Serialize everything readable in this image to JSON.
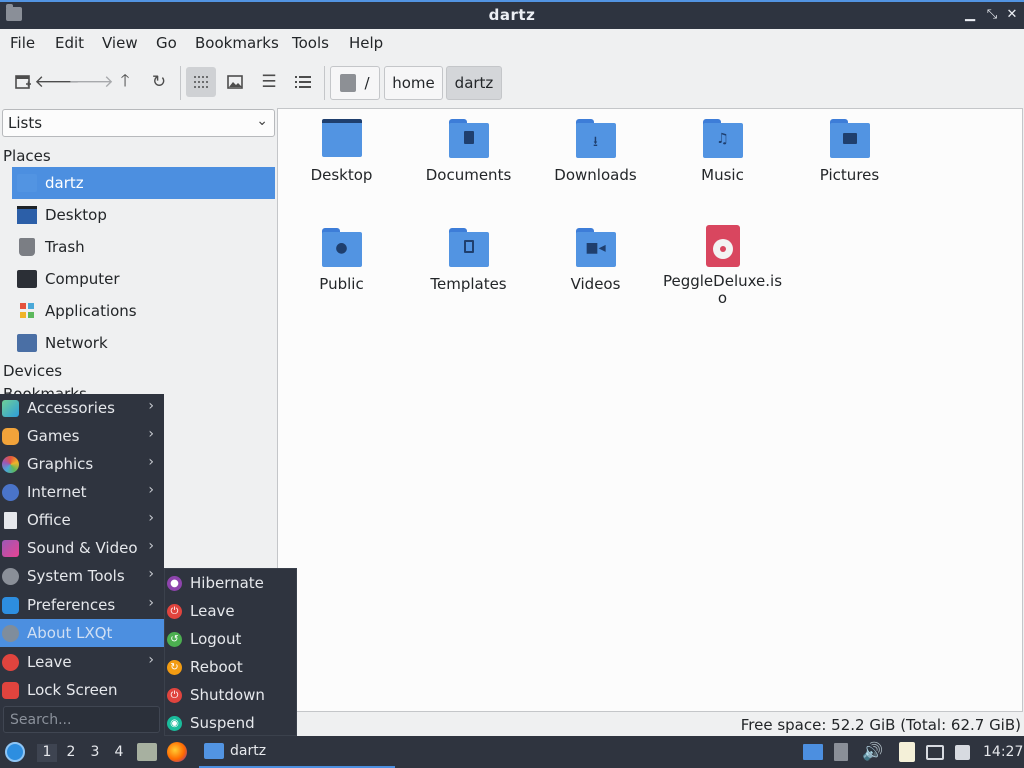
{
  "window": {
    "title": "dartz"
  },
  "menubar": [
    "File",
    "Edit",
    "View",
    "Go",
    "Bookmarks",
    "Tools",
    "Help"
  ],
  "breadcrumb": {
    "root": "/",
    "parts": [
      "home",
      "dartz"
    ]
  },
  "side": {
    "dropdown_value": "Lists",
    "places_header": "Places",
    "places": [
      "dartz",
      "Desktop",
      "Trash",
      "Computer",
      "Applications",
      "Network"
    ],
    "devices_header": "Devices",
    "bookmarks_header": "Bookmarks"
  },
  "files": [
    {
      "name": "Desktop",
      "icon": "desktop-folder-icon"
    },
    {
      "name": "Documents",
      "icon": "documents-folder-icon"
    },
    {
      "name": "Downloads",
      "icon": "downloads-folder-icon"
    },
    {
      "name": "Music",
      "icon": "music-folder-icon"
    },
    {
      "name": "Pictures",
      "icon": "pictures-folder-icon"
    },
    {
      "name": "Public",
      "icon": "public-folder-icon"
    },
    {
      "name": "Templates",
      "icon": "templates-folder-icon"
    },
    {
      "name": "Videos",
      "icon": "videos-folder-icon"
    },
    {
      "name": "PeggleDeluxe.iso",
      "name_line1": "PeggleDeluxe.is",
      "name_line2": "o",
      "icon": "disc-image-icon"
    }
  ],
  "status": {
    "free_space": "Free space: 52.2 GiB (Total: 62.7 GiB)"
  },
  "start_menu": {
    "items": [
      "Accessories",
      "Games",
      "Graphics",
      "Internet",
      "Office",
      "Sound & Video",
      "System Tools",
      "Preferences",
      "About LXQt",
      "Leave",
      "Lock Screen"
    ],
    "search_placeholder": "Search..."
  },
  "leave_submenu": [
    "Hibernate",
    "Leave",
    "Logout",
    "Reboot",
    "Shutdown",
    "Suspend"
  ],
  "taskbar": {
    "desktops": [
      "1",
      "2",
      "3",
      "4"
    ],
    "active_window": "dartz",
    "clock": "14:27"
  },
  "colors": {
    "accent": "#4c8fe0",
    "folder": "#5294e2",
    "panel": "#2f343f",
    "iso": "#d9465f"
  }
}
